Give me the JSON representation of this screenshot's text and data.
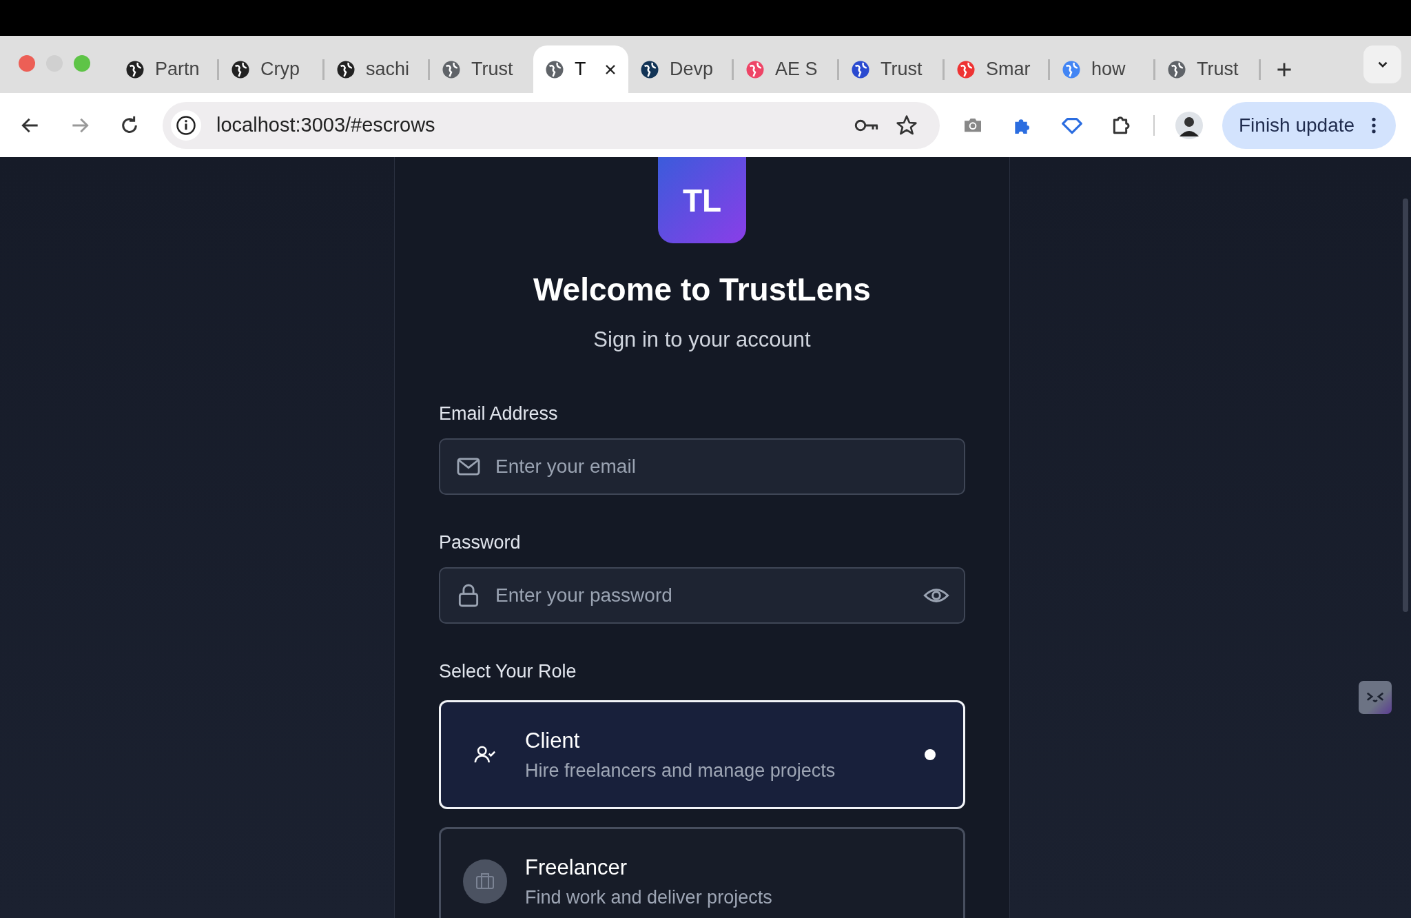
{
  "browser": {
    "tabs": [
      {
        "title": "Partn",
        "selected": false
      },
      {
        "title": "Cryp",
        "selected": false
      },
      {
        "title": "sachi",
        "selected": false
      },
      {
        "title": "Trust",
        "selected": false
      },
      {
        "title": "T",
        "selected": true
      },
      {
        "title": "Devp",
        "selected": false
      },
      {
        "title": "AE S",
        "selected": false
      },
      {
        "title": "Trust",
        "selected": false
      },
      {
        "title": "Smar",
        "selected": false
      },
      {
        "title": "how",
        "selected": false
      },
      {
        "title": "Trust",
        "selected": false
      }
    ],
    "url": "localhost:3003/#escrows",
    "update_button": "Finish update"
  },
  "login": {
    "logo": "TL",
    "title": "Welcome to TrustLens",
    "subtitle": "Sign in to your account",
    "email": {
      "label": "Email Address",
      "placeholder": "Enter your email"
    },
    "password": {
      "label": "Password",
      "placeholder": "Enter your password"
    },
    "role_label": "Select Your Role",
    "roles": [
      {
        "title": "Client",
        "description": "Hire freelancers and manage projects",
        "selected": true
      },
      {
        "title": "Freelancer",
        "description": "Find work and deliver projects",
        "selected": false
      }
    ]
  }
}
